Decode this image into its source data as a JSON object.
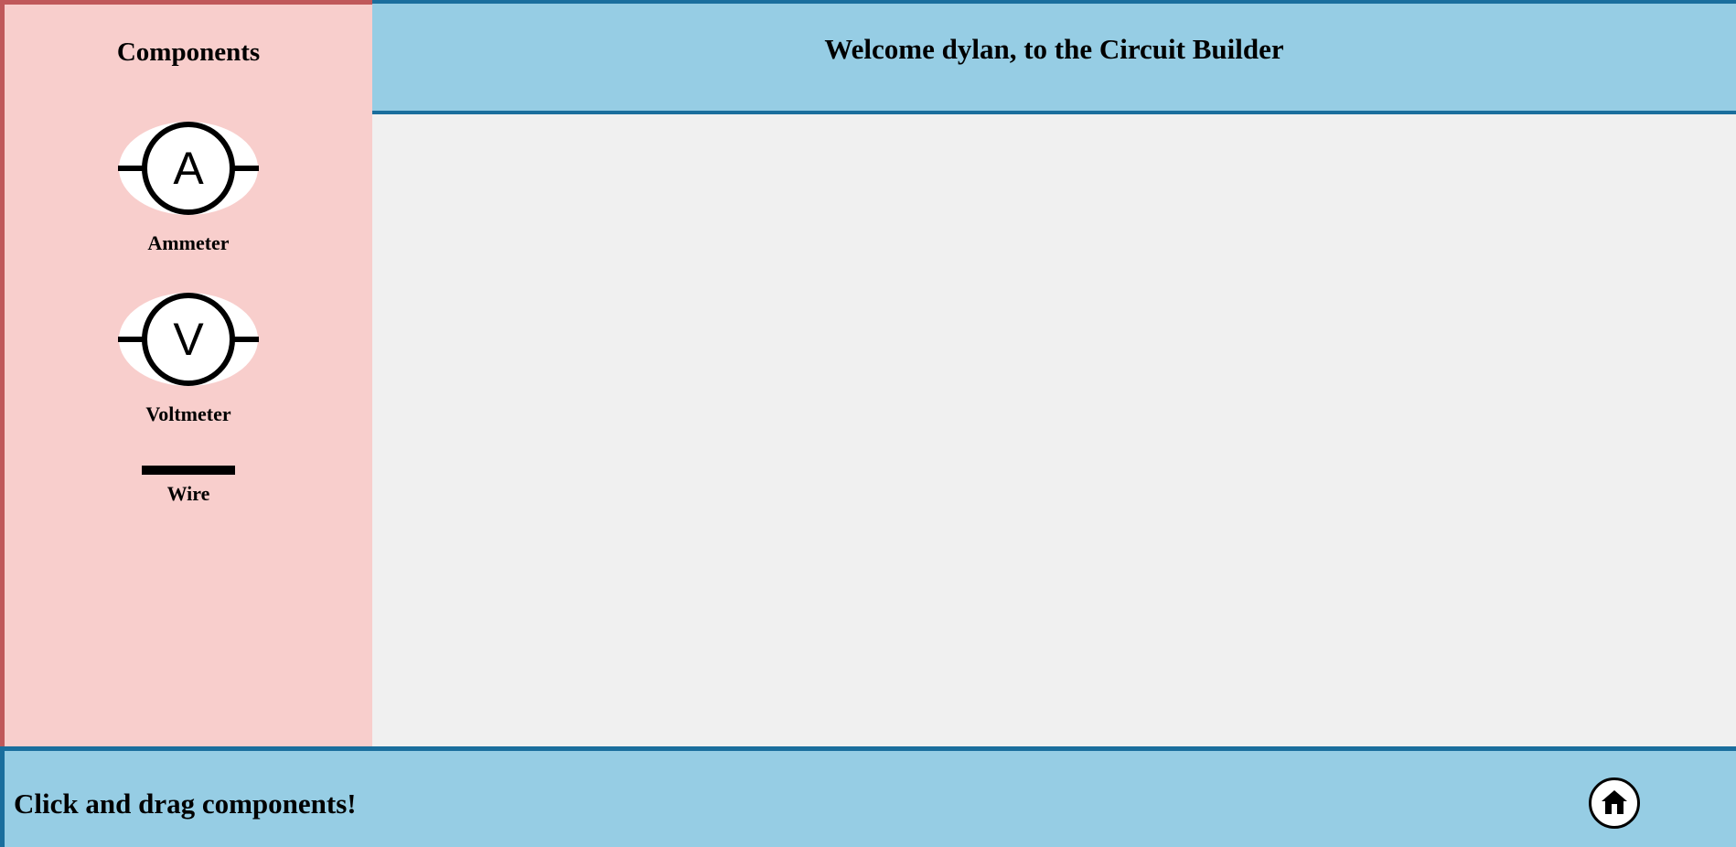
{
  "sidebar": {
    "title": "Components",
    "components": [
      {
        "label": "Ammeter",
        "symbol": "A",
        "icon": "ammeter-icon"
      },
      {
        "label": "Voltmeter",
        "symbol": "V",
        "icon": "voltmeter-icon"
      },
      {
        "label": "Wire",
        "icon": "wire-icon"
      }
    ]
  },
  "header": {
    "title": "Welcome dylan, to the Circuit Builder"
  },
  "footer": {
    "instruction": "Click and drag components!",
    "home_icon": "home-icon"
  },
  "colors": {
    "sidebar_bg": "#f8cecc",
    "sidebar_border": "#c0585a",
    "header_bg": "#96cde4",
    "header_border": "#1a6e9d",
    "canvas_bg": "#f0f0f0"
  }
}
